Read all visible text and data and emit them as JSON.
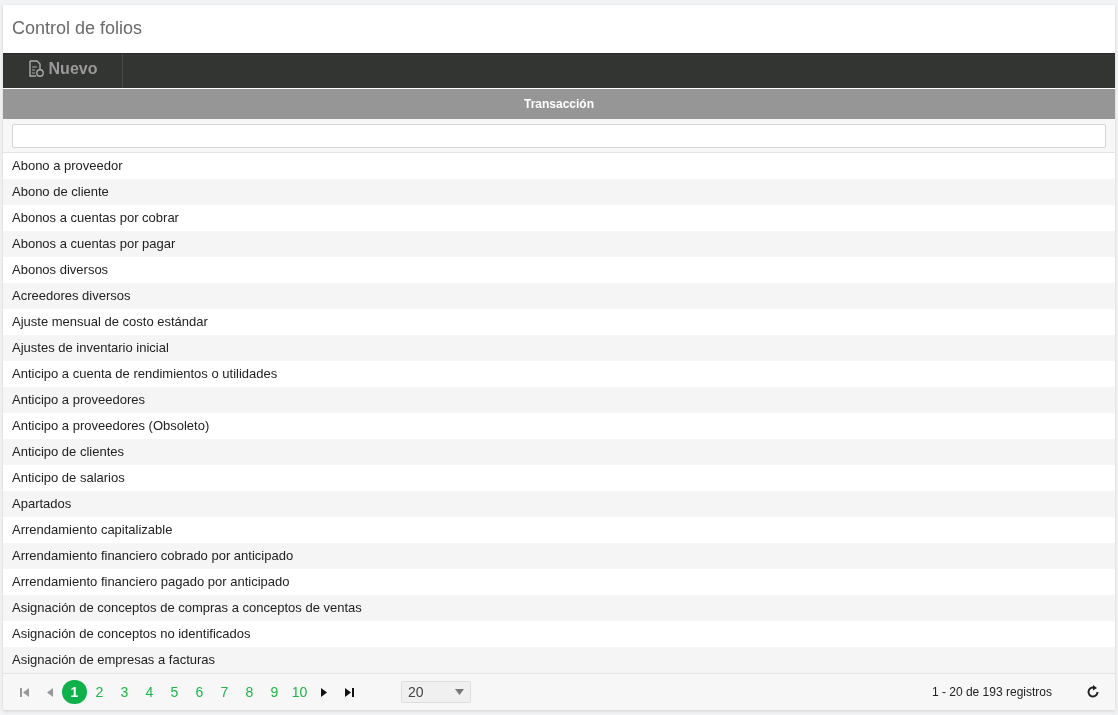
{
  "page_title": "Control de folios",
  "toolbar": [
    {
      "label": "Nuevo"
    }
  ],
  "table": {
    "columns": [
      "Transacción"
    ],
    "rows": [
      "Abono a proveedor",
      "Abono de cliente",
      "Abonos a cuentas por cobrar",
      "Abonos a cuentas por pagar",
      "Abonos diversos",
      "Acreedores diversos",
      "Ajuste mensual de costo estándar",
      "Ajustes de inventario inicial",
      "Anticipo a cuenta de rendimientos o utilidades",
      "Anticipo a proveedores",
      "Anticipo a proveedores (Obsoleto)",
      "Anticipo de clientes",
      "Anticipo de salarios",
      "Apartados",
      "Arrendamiento capitalizable",
      "Arrendamiento financiero cobrado por anticipado",
      "Arrendamiento financiero pagado por anticipado",
      "Asignación de conceptos de compras a conceptos de ventas",
      "Asignación de conceptos no identificados",
      "Asignación de empresas a facturas"
    ]
  },
  "pager": {
    "first_disabled": true,
    "prev_disabled": true,
    "pages": [
      {
        "label": "1",
        "selected": true
      },
      {
        "label": "2",
        "selected": false
      },
      {
        "label": "3",
        "selected": false
      },
      {
        "label": "4",
        "selected": false
      },
      {
        "label": "5",
        "selected": false
      },
      {
        "label": "6",
        "selected": false
      },
      {
        "label": "7",
        "selected": false
      },
      {
        "label": "8",
        "selected": false
      },
      {
        "label": "9",
        "selected": false
      },
      {
        "label": "10",
        "selected": false
      }
    ],
    "page_size": "20",
    "info": "1 - 20 de 193 registros"
  }
}
